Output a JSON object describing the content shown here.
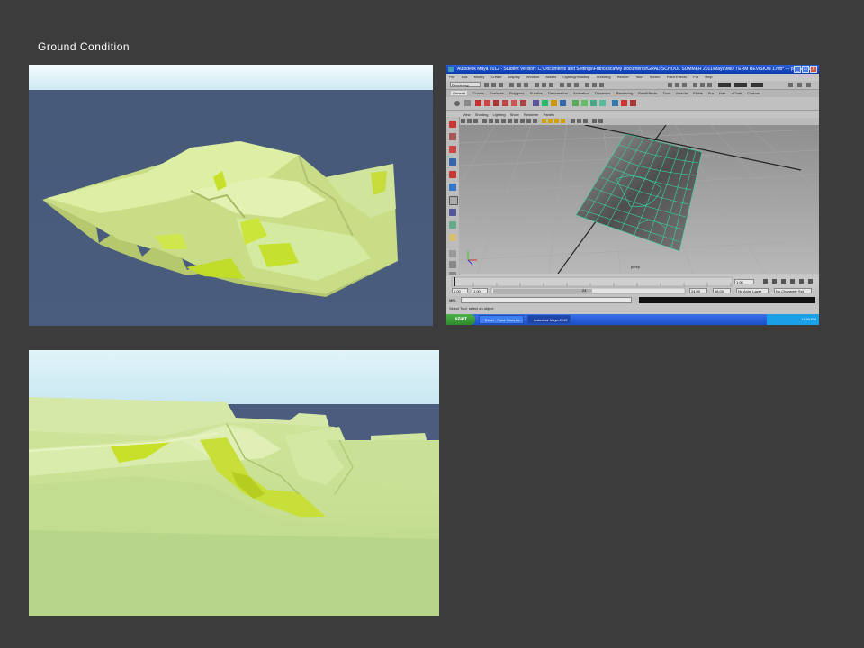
{
  "slide": {
    "title": "Ground  Condition"
  },
  "maya": {
    "window_title": "Autodesk Maya 2012 - Student Version: C:\\Documents and Settings\\Francesca\\My Documents\\GRAD SCHOOL SUMMER 2011\\Maya\\MID TERM REVISION 1.mb* --- polySurface1",
    "window_buttons": {
      "minimize": "_",
      "maximize": "□",
      "close": "x"
    },
    "menus": [
      "File",
      "Edit",
      "Modify",
      "Create",
      "Display",
      "Window",
      "Assets",
      "Lighting/Shading",
      "Texturing",
      "Render",
      "Toon",
      "Stereo",
      "Paint Effects",
      "Fur",
      "Help"
    ],
    "mode": "Rendering",
    "shelf_tabs": [
      "General",
      "Curves",
      "Surfaces",
      "Polygons",
      "Subdivs",
      "Deformation",
      "Animation",
      "Dynamics",
      "Rendering",
      "PaintEffects",
      "Toon",
      "Muscle",
      "Fluids",
      "Fur",
      "Hair",
      "nCloth",
      "Custom"
    ],
    "active_shelf_tab": "General",
    "panel_menus": [
      "View",
      "Shading",
      "Lighting",
      "Show",
      "Renderer",
      "Panels"
    ],
    "viewport_label": "persp",
    "time": {
      "current": "1.00",
      "start": "1.00",
      "range_start": "1.00",
      "range_end_field": "24",
      "end": "24.00",
      "anim_end": "48.00",
      "anim_layer": "No Anim Layer",
      "character_set": "No Character Set"
    },
    "cmd_label": "MEL",
    "help_line": "Select Tool: select an object"
  },
  "taskbar": {
    "start_label": "start",
    "items": [
      "Excel - Point Grow.fls ...",
      "Autodesk Maya 2012 ..."
    ],
    "clock": "11:39 PM"
  },
  "colors": {
    "terrain_light": "#d6ec9a",
    "terrain_bright": "#c8e02a",
    "water": "#485a7c",
    "sky": "#dff2f8",
    "maya_wire": "#36d8a8"
  }
}
